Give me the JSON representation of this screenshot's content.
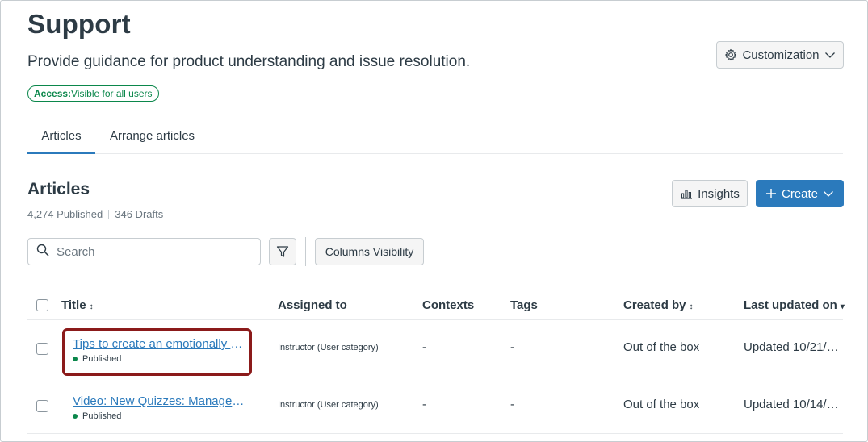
{
  "header": {
    "title": "Support",
    "description": "Provide guidance for product understanding and issue resolution.",
    "access_label": "Access:",
    "access_value": "Visible for all users",
    "customization_label": "Customization"
  },
  "tabs": [
    {
      "label": "Articles",
      "selected": true
    },
    {
      "label": "Arrange articles",
      "selected": false
    }
  ],
  "articles_section": {
    "title": "Articles",
    "published_count": "4,274 Published",
    "drafts_count": "346 Drafts",
    "insights_label": "Insights",
    "create_label": "Create"
  },
  "toolbar": {
    "search_placeholder": "Search",
    "columns_label": "Columns Visibility"
  },
  "table": {
    "headers": {
      "title": "Title",
      "assigned_to": "Assigned to",
      "contexts": "Contexts",
      "tags": "Tags",
      "created_by": "Created by",
      "last_updated": "Last updated on"
    },
    "rows": [
      {
        "title": "Tips to create an emotionally aw...",
        "status": "Published",
        "assigned_to": "Instructor (User category)",
        "contexts": "-",
        "tags": "-",
        "created_by": "Out of the box",
        "last_updated": "Updated 10/21/2..."
      },
      {
        "title": "Video: New Quizzes: Manage St...",
        "status": "Published",
        "assigned_to": "Instructor (User category)",
        "contexts": "-",
        "tags": "-",
        "created_by": "Out of the box",
        "last_updated": "Updated 10/14/2..."
      }
    ]
  },
  "colors": {
    "accent": "#2b7abc",
    "published": "#0b874b",
    "highlight": "#8b1a1a",
    "text": "#2d3b45"
  },
  "icons": [
    "gear-icon",
    "chevron-down-icon",
    "chart-icon",
    "plus-icon",
    "search-icon",
    "filter-icon",
    "sort-icon"
  ]
}
